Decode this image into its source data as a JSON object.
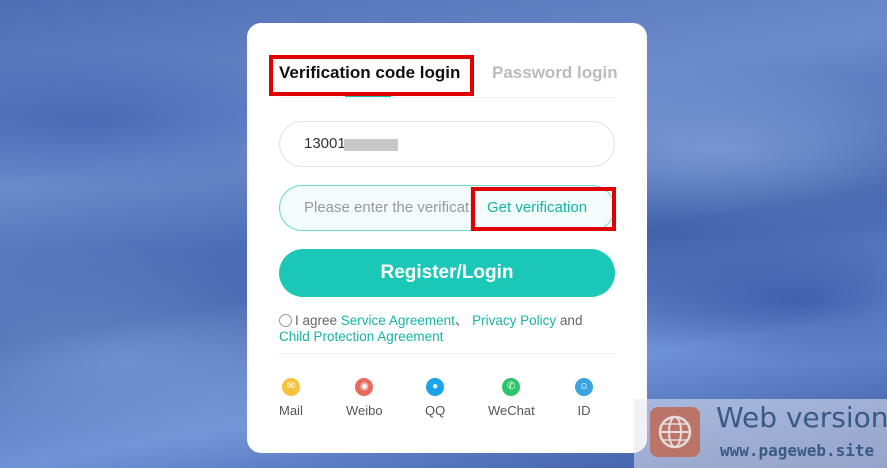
{
  "tabs": {
    "active": "Verification code login",
    "inactive": "Password login"
  },
  "phone": {
    "value": "13001"
  },
  "code": {
    "placeholder": "Please enter the verification code",
    "button": "Get verification"
  },
  "submit_label": "Register/Login",
  "agreement": {
    "prefix": "I agree",
    "service": "Service Agreement",
    "separator": "、",
    "privacy": "Privacy Policy",
    "and": "and",
    "child": "Child Protection Agreement"
  },
  "socials": [
    {
      "label": "Mail",
      "icon": "mail-icon",
      "color": "#f5c33b"
    },
    {
      "label": "Weibo",
      "icon": "weibo-icon",
      "color": "#e86b5d"
    },
    {
      "label": "QQ",
      "icon": "qq-icon",
      "color": "#1aa3e8"
    },
    {
      "label": "WeChat",
      "icon": "wechat-icon",
      "color": "#2cc56b"
    },
    {
      "label": "ID",
      "icon": "id-icon",
      "color": "#3aa3e0"
    }
  ],
  "watermark": {
    "title": "Web version",
    "url": "www.pageweb.site"
  },
  "colors": {
    "accent": "#1bc8b8",
    "link": "#17b3a6",
    "highlight": "#e00000"
  }
}
